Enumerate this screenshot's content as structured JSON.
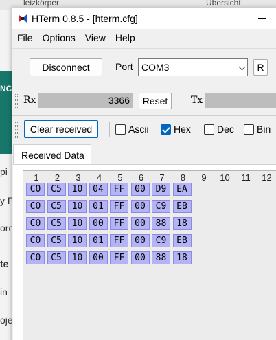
{
  "background": {
    "top_left_text": "leizkörper",
    "top_right_text": "Übersicht",
    "left_words": [
      "pi",
      "y P",
      "oro",
      "te",
      "in",
      "oje"
    ],
    "green_label": "NC"
  },
  "window": {
    "title": "HTerm 0.8.5 - [hterm.cfg]"
  },
  "menu": [
    "File",
    "Options",
    "View",
    "Help"
  ],
  "connection": {
    "disconnect_label": "Disconnect",
    "port_label": "Port",
    "port_value": "COM3",
    "r_label": "R"
  },
  "counters": {
    "rx_label": "Rx",
    "rx_value": "3366",
    "reset_label": "Reset",
    "tx_label": "Tx"
  },
  "options": {
    "clear_label": "Clear received",
    "ascii_label": "Ascii",
    "ascii_checked": false,
    "hex_label": "Hex",
    "hex_checked": true,
    "dec_label": "Dec",
    "dec_checked": false,
    "bin_label": "Bin",
    "bin_checked": false
  },
  "received": {
    "tab_label": "Received Data",
    "columns": [
      "1",
      "2",
      "3",
      "4",
      "5",
      "6",
      "7",
      "8",
      "9",
      "10",
      "11",
      "12"
    ],
    "rows": [
      [
        "C0",
        "C5",
        "10",
        "04",
        "FF",
        "00",
        "D9",
        "EA"
      ],
      [
        "C0",
        "C5",
        "10",
        "01",
        "FF",
        "00",
        "C9",
        "EB"
      ],
      [
        "C0",
        "C5",
        "10",
        "00",
        "FF",
        "00",
        "88",
        "18"
      ],
      [
        "C0",
        "C5",
        "10",
        "01",
        "FF",
        "00",
        "C9",
        "EB"
      ],
      [
        "C0",
        "C5",
        "10",
        "00",
        "FF",
        "00",
        "88",
        "18"
      ]
    ]
  }
}
